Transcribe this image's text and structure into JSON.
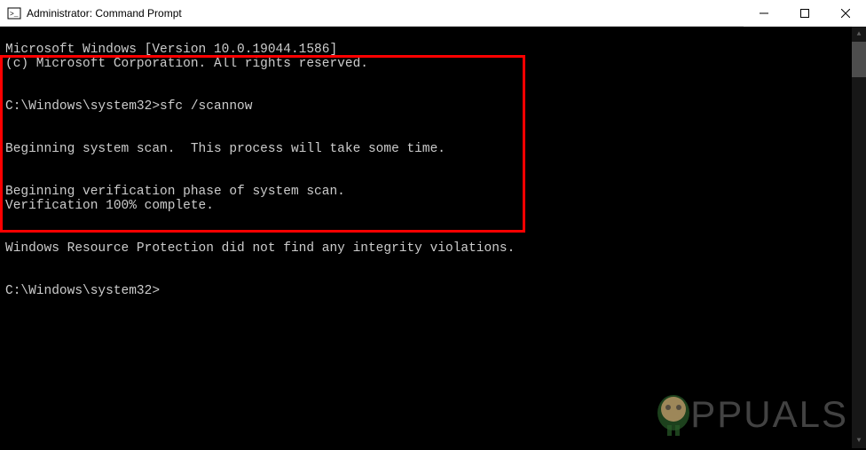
{
  "window": {
    "title": "Administrator: Command Prompt"
  },
  "terminal": {
    "line1": "Microsoft Windows [Version 10.0.19044.1586]",
    "line2": "(c) Microsoft Corporation. All rights reserved.",
    "prompt1": "C:\\Windows\\system32>",
    "command1": "sfc /scannow",
    "out1": "Beginning system scan.  This process will take some time.",
    "out2": "Beginning verification phase of system scan.",
    "out3": "Verification 100% complete.",
    "out4": "Windows Resource Protection did not find any integrity violations.",
    "prompt2": "C:\\Windows\\system32>"
  },
  "watermark": {
    "text": "PPUALS"
  }
}
